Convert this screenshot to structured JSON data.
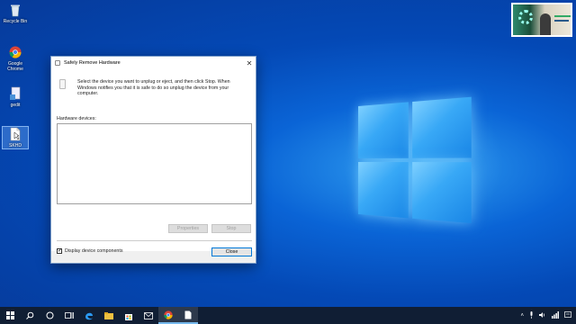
{
  "desktop": {
    "icons": [
      {
        "label": "Recycle Bin"
      },
      {
        "label": "Google Chrome"
      },
      {
        "label": "gedit"
      },
      {
        "label": "SKHD"
      }
    ]
  },
  "dialog": {
    "title": "Safely Remove Hardware",
    "close_glyph": "✕",
    "intro": "Select the device you want to unplug or eject, and then click Stop. When Windows notifies you that it is safe to do so unplug the device from your computer.",
    "hardware_label": "Hardware devices:",
    "hardware_devices": [],
    "properties_label": "Properties",
    "stop_label": "Stop",
    "display_components_label": "Display device components",
    "display_components_checked": true,
    "close_label": "Close"
  },
  "taskbar": {
    "icons": [
      "windows-start-icon",
      "search-icon",
      "cortana-icon",
      "task-view-icon",
      "edge-icon",
      "file-explorer-icon",
      "store-icon",
      "mail-icon",
      "chrome-icon",
      "document-icon"
    ],
    "tray": [
      "chevron-up-icon",
      "microphone-icon",
      "speaker-icon",
      "network-icon",
      "notification-icon"
    ]
  },
  "colors": {
    "accent": "#0078d7",
    "taskbar": "#101e34",
    "desktop": "#0a64d6"
  }
}
